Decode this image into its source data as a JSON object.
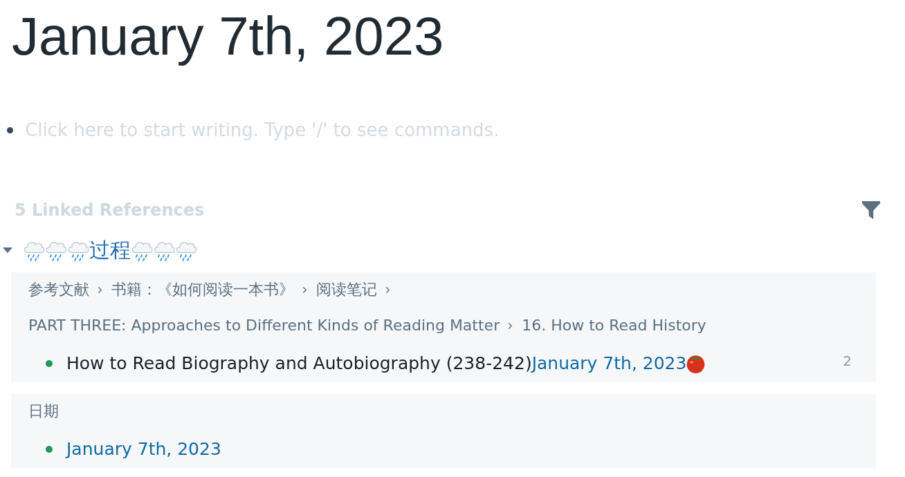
{
  "page": {
    "title": "January 7th, 2023"
  },
  "editor": {
    "placeholder": "Click here to start writing. Type '/' to see commands."
  },
  "linked_references": {
    "heading": "5 Linked References",
    "groups": [
      {
        "expanded": true,
        "title_parts": [
          {
            "kind": "icon"
          },
          {
            "kind": "icon"
          },
          {
            "kind": "icon"
          },
          {
            "kind": "text",
            "text": "过程"
          },
          {
            "kind": "icon"
          },
          {
            "kind": "icon"
          },
          {
            "kind": "icon"
          }
        ],
        "blocks": [
          {
            "breadcrumbs": [
              "参考文献",
              "书籍：《如何阅读一本书》",
              "阅读笔记",
              "PART THREE: Approaches to Different Kinds of Reading Matter",
              "16. How to Read History"
            ],
            "items": [
              {
                "content": [
                  {
                    "kind": "text",
                    "text": "How to Read Biography and Autobiography (238-242)"
                  },
                  {
                    "kind": "link",
                    "text": "January 7th, 2023"
                  },
                  {
                    "kind": "icon"
                  }
                ],
                "count": "2"
              }
            ]
          },
          {
            "breadcrumbs": [
              "日期"
            ],
            "items": [
              {
                "content": [
                  {
                    "kind": "link",
                    "text": "January 7th, 2023"
                  }
                ]
              }
            ]
          }
        ]
      }
    ]
  }
}
